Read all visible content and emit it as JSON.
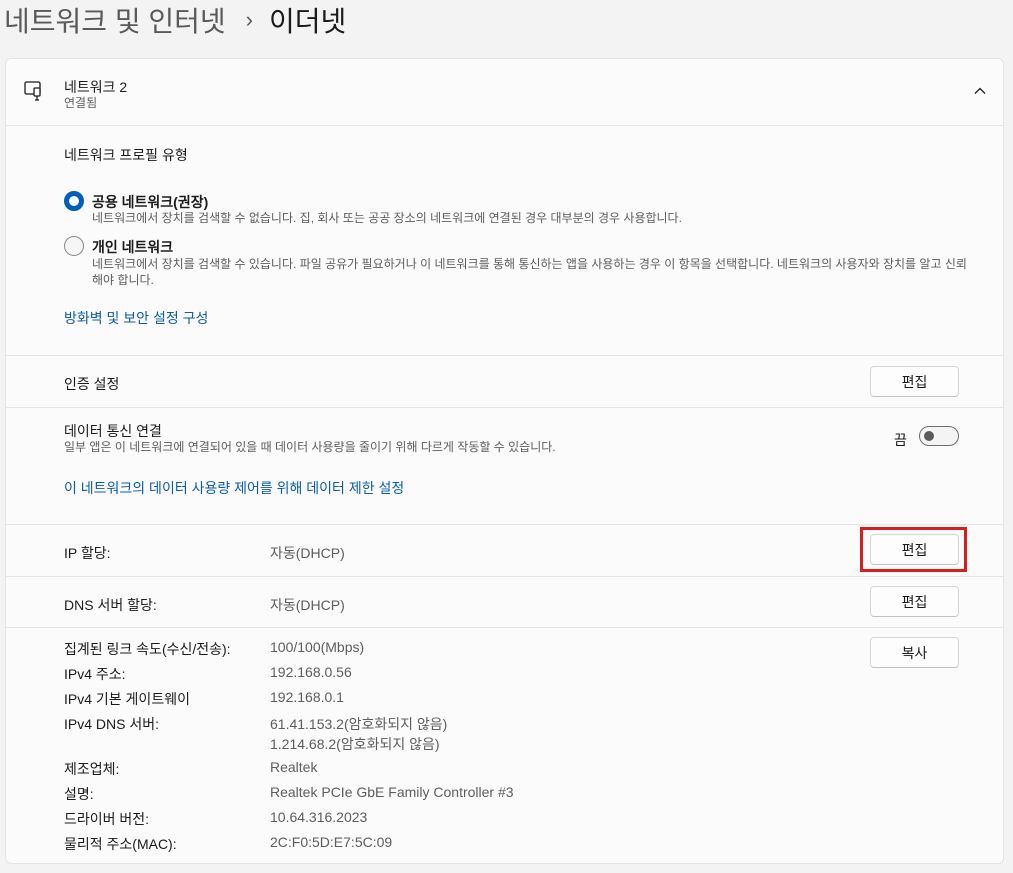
{
  "breadcrumb": {
    "parent": "네트워크 및 인터넷",
    "separator": "›",
    "current": "이더넷"
  },
  "header": {
    "icon": "ethernet-icon",
    "title": "네트워크 2",
    "subtitle": "연결됨",
    "chevron": "chevron-up-icon"
  },
  "profile": {
    "heading": "네트워크 프로필 유형",
    "options": [
      {
        "title": "공용 네트워크(권장)",
        "description": "네트워크에서 장치를 검색할 수 없습니다. 집, 회사 또는 공공 장소의 네트워크에 연결된 경우 대부분의 경우 사용합니다.",
        "selected": true
      },
      {
        "title": "개인 네트워크",
        "description": "네트워크에서 장치를 검색할 수 있습니다. 파일 공유가 필요하거나 이 네트워크를 통해 통신하는 앱을 사용하는 경우 이 항목을 선택합니다. 네트워크의 사용자와 장치를 알고 신뢰해야 합니다.",
        "selected": false
      }
    ],
    "firewall_link": "방화벽 및 보안 설정 구성"
  },
  "auth": {
    "label": "인증 설정",
    "button": "편집"
  },
  "metered": {
    "label": "데이터 통신 연결",
    "description": "일부 앱은 이 네트워크에 연결되어 있을 때 데이터 사용량을 줄이기 위해 다르게 작동할 수 있습니다.",
    "toggle_state": "끔",
    "toggle_on": false,
    "data_limit_link": "이 네트워크의 데이터 사용량 제어를 위해 데이터 제한 설정"
  },
  "ip_assignment": {
    "label": "IP 할당:",
    "value": "자동(DHCP)",
    "button": "편집"
  },
  "dns_assignment": {
    "label": "DNS 서버 할당:",
    "value": "자동(DHCP)",
    "button": "편집"
  },
  "properties": {
    "copy_button": "복사",
    "link_speed_label": "집계된 링크 속도(수신/전송):",
    "link_speed_value": "100/100(Mbps)",
    "ipv4_label": "IPv4 주소:",
    "ipv4_value": "192.168.0.56",
    "gateway_label": "IPv4 기본 게이트웨이",
    "gateway_value": "192.168.0.1",
    "dns_label": "IPv4 DNS 서버:",
    "dns_value_1": "61.41.153.2(암호화되지 않음)",
    "dns_value_2": "1.214.68.2(암호화되지 않음)",
    "manufacturer_label": "제조업체:",
    "manufacturer_value": "Realtek",
    "description_label": "설명:",
    "description_value": "Realtek PCIe GbE Family Controller #3",
    "driver_label": "드라이버 버전:",
    "driver_value": "10.64.316.2023",
    "mac_label": "물리적 주소(MAC):",
    "mac_value": "2C:F0:5D:E7:5C:09"
  },
  "colors": {
    "accent": "#005fb8",
    "link": "#0b5cad",
    "highlight_box": "#d81e1e"
  }
}
